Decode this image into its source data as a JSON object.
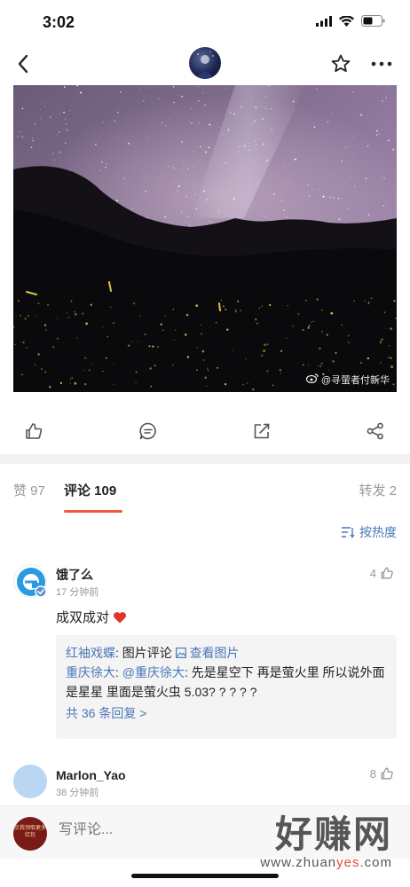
{
  "status_bar": {
    "time": "3:02"
  },
  "post": {
    "image_watermark": "@寻萤者付新华"
  },
  "tabs": [
    {
      "label": "赞 97"
    },
    {
      "label": "评论 109"
    },
    {
      "label": "转发 2"
    }
  ],
  "sort": {
    "label": "按热度"
  },
  "comments": [
    {
      "name": "饿了么",
      "time": "17 分钟前",
      "likes": "4",
      "text": "成双成对",
      "reply": {
        "author1": "红袖戏蝶",
        "text1": ": 图片评论 ",
        "view_image": "查看图片",
        "author2": "重庆徐大",
        "mention": "@重庆徐大",
        "text2": ": 先是星空下 再是萤火里 所以说外面是星星 里面是萤火虫 5.03? ? ? ? ?",
        "more": "共 36 条回复 >"
      }
    },
    {
      "name": "Marlon_Yao",
      "time": "38 分钟前",
      "likes": "8"
    }
  ],
  "bottom_bar": {
    "redpacket_text": "点我领取更多红包",
    "input_placeholder": "写评论..."
  },
  "site_watermark": {
    "logo_text": "好赚网",
    "url_prefix": "www.zhuan",
    "url_accent": "yes",
    "url_suffix": ".com"
  },
  "colors": {
    "accent": "#f25a3a",
    "link": "#4a78b8",
    "heart": "#e0342c"
  },
  "icons": {
    "back": "chevron-left-icon",
    "favorite": "star-icon",
    "more": "more-dots-icon",
    "like": "thumbs-up-icon",
    "comment": "comment-bubble-icon",
    "repost": "repost-icon",
    "share": "share-icon",
    "sort": "sort-icon",
    "image": "image-icon",
    "heart": "heart-icon",
    "weibo": "weibo-logo-icon"
  }
}
